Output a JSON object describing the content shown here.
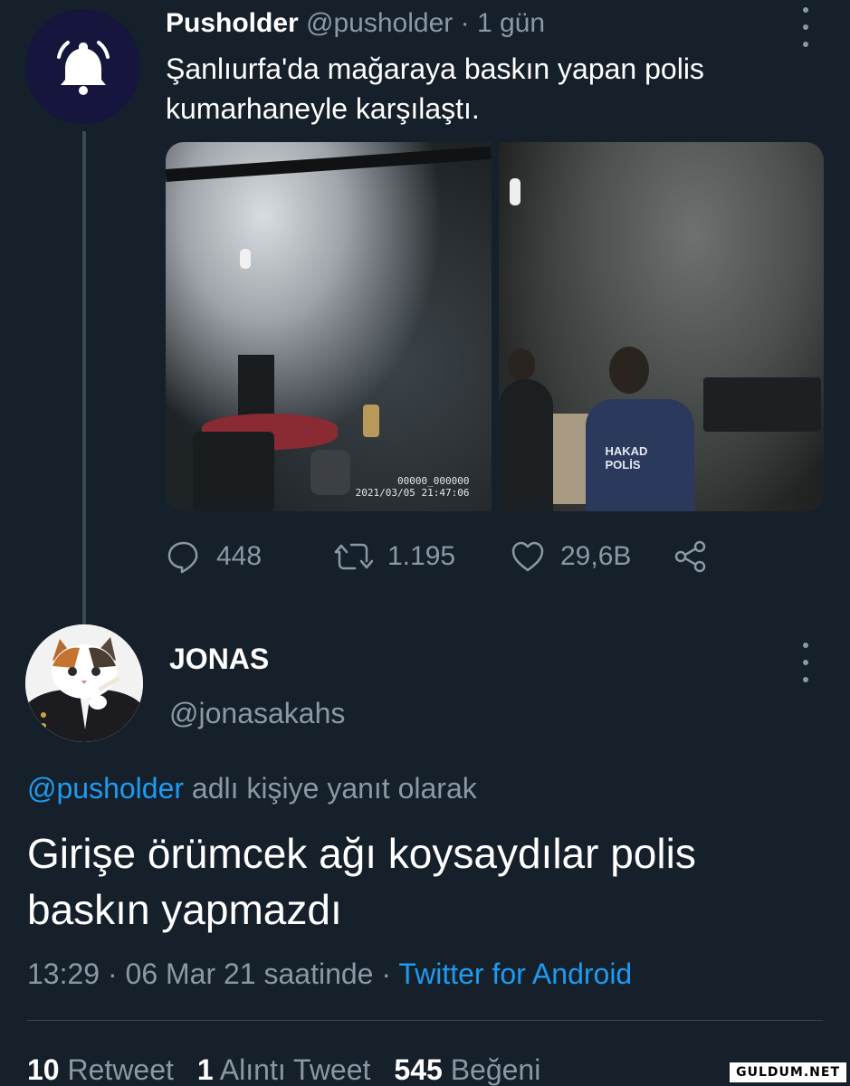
{
  "parent_tweet": {
    "name": "Pusholder",
    "handle": "@pusholder",
    "separator": "·",
    "time": "1 gün",
    "text": "Şanlıurfa'da mağaraya baskın yapan polis kumarhaneyle karşılaştı.",
    "avatar_icon": "bell-icon",
    "media": {
      "left_photo_timestamp_line1": "00000_000000",
      "left_photo_timestamp_line2": "2021/03/05 21:47:06",
      "right_photo_vest_line1": "HAKAD",
      "right_photo_vest_line2": "POLİS"
    },
    "actions": {
      "replies": "448",
      "retweets": "1.195",
      "likes": "29,6B",
      "reply_icon": "comment-icon",
      "retweet_icon": "retweet-icon",
      "like_icon": "heart-icon",
      "share_icon": "share-icon"
    }
  },
  "reply_tweet": {
    "name": "JONAS",
    "handle": "@jonasakahs",
    "avatar_icon": "cat-avatar",
    "replying_to_mention": "@pusholder",
    "replying_to_suffix": "adlı kişiye yanıt olarak",
    "text": "Girişe örümcek ağı koysaydılar polis baskın yapmazdı",
    "time": "13:29 · 06 Mar 21 saatinde",
    "meta_separator": "·",
    "source": "Twitter for Android",
    "stats": {
      "retweet_count": "10",
      "retweet_label": "Retweet",
      "quote_count": "1",
      "quote_label": "Alıntı Tweet",
      "like_count": "545",
      "like_label": "Beğeni"
    }
  },
  "watermark": "GULDUM.NET",
  "colors": {
    "background": "#15202b",
    "muted": "#8b98a5",
    "accent": "#1d9bf0",
    "divider": "#38444d"
  }
}
